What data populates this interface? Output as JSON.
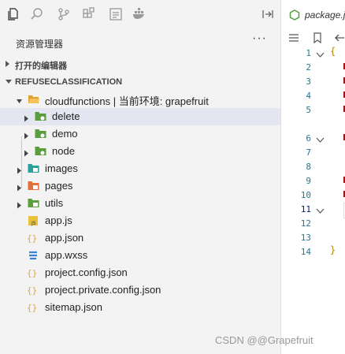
{
  "activity_bar": {
    "icons": [
      "explorer-icon",
      "search-icon",
      "source-control-icon",
      "extensions-icon",
      "cloud-dev-icon",
      "docker-icon"
    ],
    "split_icon": "split-editor-icon"
  },
  "sidebar": {
    "title": "资源管理器",
    "more": "···",
    "sections": {
      "open_editors": "打开的编辑器",
      "project": "REFUSECLASSIFICATION"
    },
    "tree": [
      {
        "label": "cloudfunctions | 当前环境: grapefruit",
        "type": "folder-open",
        "color": "#e0a030"
      },
      {
        "label": "delete",
        "type": "folder-cloud",
        "color": "#5a9e3e",
        "selected": true
      },
      {
        "label": "demo",
        "type": "folder-cloud",
        "color": "#5a9e3e"
      },
      {
        "label": "node",
        "type": "folder-cloud",
        "color": "#5a9e3e"
      },
      {
        "label": "images",
        "type": "folder",
        "color": "#2aa198"
      },
      {
        "label": "pages",
        "type": "folder",
        "color": "#e2703a"
      },
      {
        "label": "utils",
        "type": "folder",
        "color": "#5a9e3e"
      },
      {
        "label": "app.js",
        "type": "file-js",
        "color": "#e8c33a"
      },
      {
        "label": "app.json",
        "type": "file-json",
        "color": "#e8a33a"
      },
      {
        "label": "app.wxss",
        "type": "file-css",
        "color": "#3b82d6"
      },
      {
        "label": "project.config.json",
        "type": "file-json",
        "color": "#e8a33a"
      },
      {
        "label": "project.private.config.json",
        "type": "file-json",
        "color": "#e8a33a"
      },
      {
        "label": "sitemap.json",
        "type": "file-json",
        "color": "#e8a33a"
      }
    ]
  },
  "editor": {
    "tab_title": "package.json",
    "line_numbers": [
      "1",
      "2",
      "3",
      "4",
      "5",
      "6",
      "7",
      "8",
      "9",
      "10",
      "11",
      "12",
      "13",
      "14"
    ],
    "open_brace": "{",
    "close_brace": "}"
  },
  "watermark": "CSDN @@Grapefruit"
}
